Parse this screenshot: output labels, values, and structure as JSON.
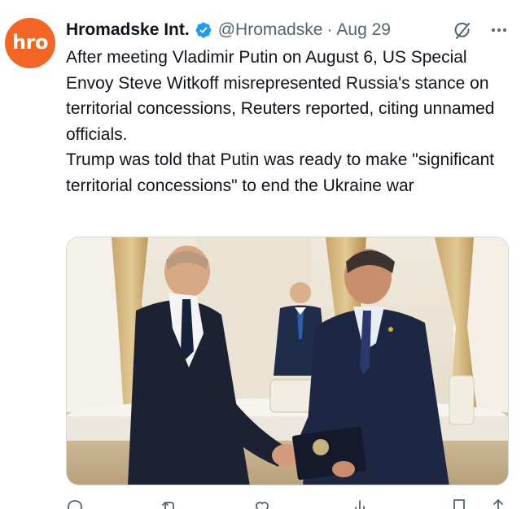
{
  "tweet": {
    "avatar_text": "hro",
    "avatar_color": "#f26522",
    "display_name": "Hromadske Int.",
    "verified": true,
    "verified_color": "#1d9bf0",
    "handle": "@Hromadske",
    "separator": "·",
    "date": "Aug 29",
    "paragraphs": [
      "After meeting Vladimir Putin on August 6, US Special Envoy Steve Witkoff misrepresented Russia's stance on territorial concessions, Reuters reported, citing unnamed officials.",
      "Trump was told that Putin was ready to make \"significant territorial concessions\" to end the Ukraine war"
    ],
    "media": {
      "type": "photo"
    },
    "actions": {
      "reply_icon": "reply-icon",
      "retweet_icon": "retweet-icon",
      "like_icon": "heart-icon",
      "views_icon": "views-icon",
      "bookmark_icon": "bookmark-icon",
      "share_icon": "share-icon"
    }
  },
  "icons": {
    "verified": "verified-badge-icon",
    "grok": "grok-icon",
    "more": "more-options-icon"
  }
}
